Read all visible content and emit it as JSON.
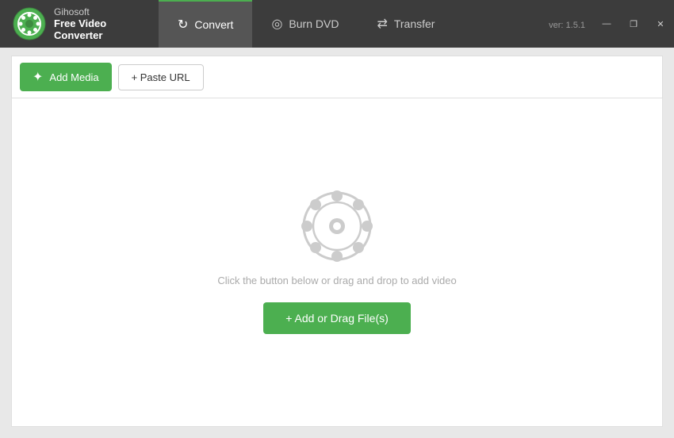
{
  "app": {
    "name_top": "Gihosoft",
    "name_bottom": "Free Video Converter",
    "version": "ver: 1.5.1"
  },
  "tabs": [
    {
      "id": "convert",
      "label": "Convert",
      "icon": "↻",
      "active": true
    },
    {
      "id": "burn-dvd",
      "label": "Burn DVD",
      "icon": "◎",
      "active": false
    },
    {
      "id": "transfer",
      "label": "Transfer",
      "icon": "⇄",
      "active": false
    }
  ],
  "window_controls": {
    "minimize": "—",
    "restore": "❐",
    "close": "✕"
  },
  "toolbar": {
    "add_media_label": "Add Media",
    "paste_url_label": "+ Paste URL"
  },
  "main": {
    "drop_hint": "Click the button below or drag and drop to add video",
    "add_files_label": "+ Add or Drag File(s)"
  }
}
